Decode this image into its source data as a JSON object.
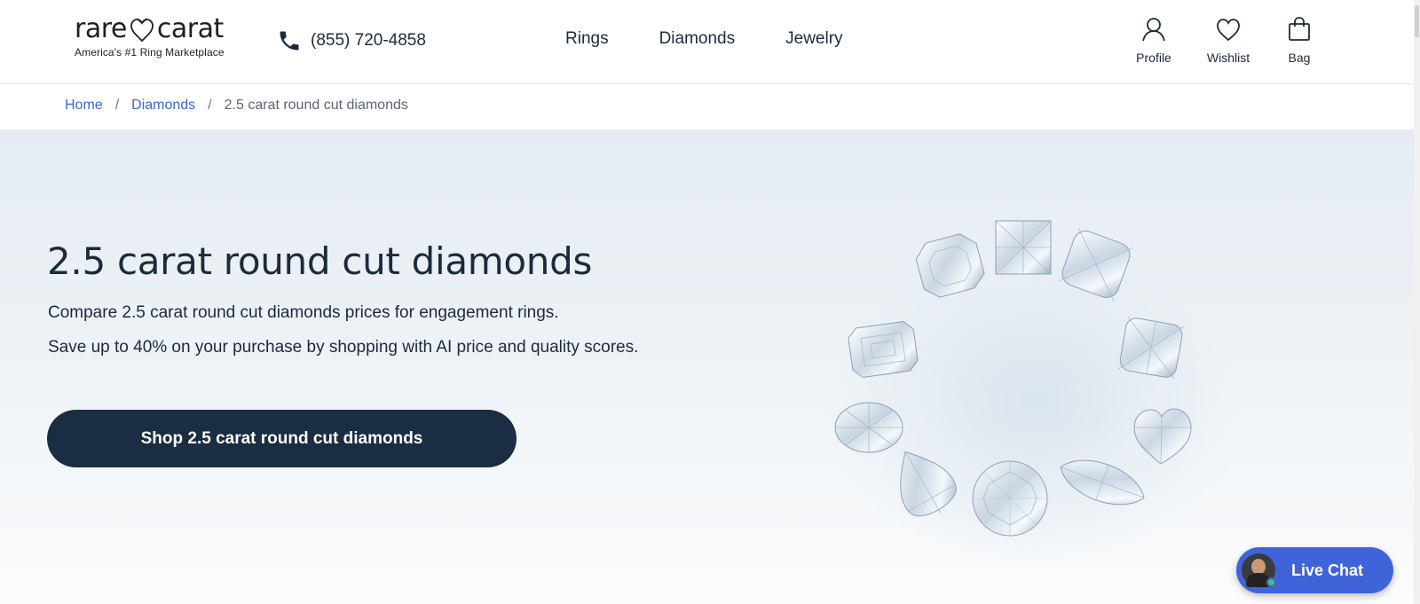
{
  "brand": {
    "logo_left": "rare",
    "logo_right": "carat",
    "tagline": "America's #1 Ring Marketplace"
  },
  "phone": {
    "number": "(855) 720-4858",
    "icon": "phone-icon"
  },
  "nav": {
    "items": [
      {
        "label": "Rings"
      },
      {
        "label": "Diamonds"
      },
      {
        "label": "Jewelry"
      }
    ]
  },
  "actions": {
    "profile": {
      "label": "Profile",
      "icon": "user-icon"
    },
    "wishlist": {
      "label": "Wishlist",
      "icon": "heart-icon"
    },
    "bag": {
      "label": "Bag",
      "icon": "bag-icon"
    }
  },
  "breadcrumb": {
    "items": [
      {
        "label": "Home"
      },
      {
        "label": "Diamonds"
      },
      {
        "label": "2.5 carat round cut diamonds"
      }
    ],
    "separator": "/"
  },
  "hero": {
    "title": "2.5 carat round cut diamonds",
    "line1": "Compare 2.5 carat round cut diamonds prices for engagement rings.",
    "line2": "Save up to 40% on your purchase by shopping with AI price and quality scores.",
    "cta_label": "Shop 2.5 carat round cut diamonds"
  },
  "chat": {
    "label": "Live Chat",
    "status_color": "#3ec46d"
  },
  "colors": {
    "primary_dark": "#1b2d42",
    "link": "#3a67d0",
    "chat": "#3f63d8"
  }
}
